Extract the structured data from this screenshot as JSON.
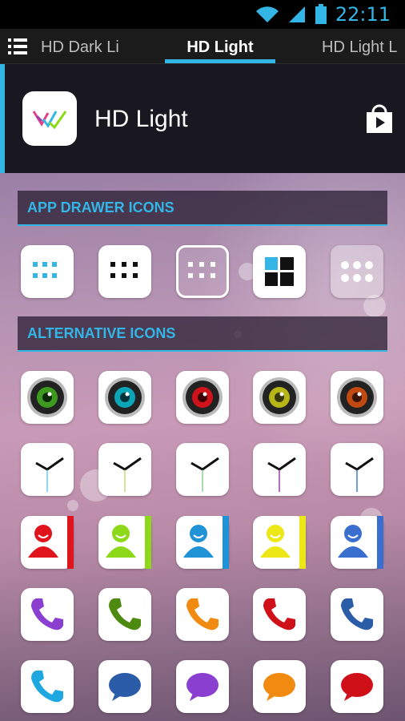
{
  "status": {
    "time": "22:11"
  },
  "tabs": {
    "left": "HD Dark Li",
    "center": "HD Light",
    "right": "HD Light L"
  },
  "header": {
    "title": "HD Light"
  },
  "sections": {
    "app_drawer": "APP DRAWER ICONS",
    "alternative": "ALTERNATIVE ICONS"
  },
  "colors": {
    "accent": "#33b5e5",
    "camera": [
      "#3e9a1e",
      "#0aa6b8",
      "#d0121a",
      "#b5b516",
      "#c04a10"
    ],
    "clock_hand": [
      "#6ec8f0",
      "#c8d87a",
      "#8fd08f",
      "#9b3db0",
      "#3b7fd0"
    ],
    "contacts": [
      "#e0141c",
      "#8ed81a",
      "#1f93d6",
      "#ece818",
      "#3a6fd0"
    ],
    "phone": [
      "#8a3fd0",
      "#4f8a10",
      "#f08a10",
      "#d01018",
      "#2a5ca8",
      "#1fa8e0"
    ],
    "message": [
      "#2a5ca8",
      "#8a3fd0",
      "#f08a10",
      "#d01018"
    ]
  },
  "icons": {
    "app_drawer": [
      "grid-blue-icon",
      "grid-black-icon",
      "grid-outline-icon",
      "tiles-icon",
      "dots-icon"
    ],
    "rows": [
      "camera-icon",
      "clock-icon",
      "contacts-icon",
      "phone-icon",
      "phone-message-icon"
    ]
  }
}
